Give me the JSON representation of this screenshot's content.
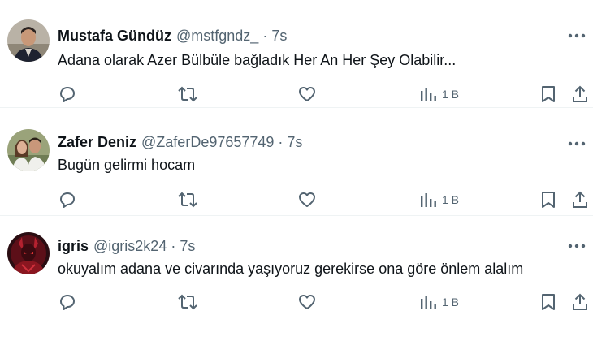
{
  "tweets": [
    {
      "name": "Mustafa Gündüz",
      "handle": "@mstfgndz_",
      "separator": "·",
      "time": "7s",
      "text": "Adana olarak Azer Bülbüle bağladık  Her An Her Şey Olabilir...",
      "views": "1 B",
      "avatar": "avatar-man-dark-jacket"
    },
    {
      "name": "Zafer Deniz",
      "handle": "@ZaferDe97657749",
      "separator": "·",
      "time": "7s",
      "text": "Bugün gelirmi hocam",
      "views": "1 B",
      "avatar": "avatar-two-people"
    },
    {
      "name": "igris",
      "handle": "@igris2k24",
      "separator": "·",
      "time": "7s",
      "text": "okuyalım adana ve civarında yaşıyoruz gerekirse ona göre önlem alalım",
      "views": "1 B",
      "avatar": "avatar-red-armor"
    }
  ],
  "icons": {
    "more": "more-horizontal-icon",
    "reply": "reply-icon",
    "retweet": "retweet-icon",
    "like": "heart-icon",
    "views": "views-bar-chart-icon",
    "bookmark": "bookmark-icon",
    "share": "share-icon"
  },
  "colors": {
    "text_primary": "#0f1419",
    "text_secondary": "#536471",
    "divider": "#eff3f4"
  }
}
